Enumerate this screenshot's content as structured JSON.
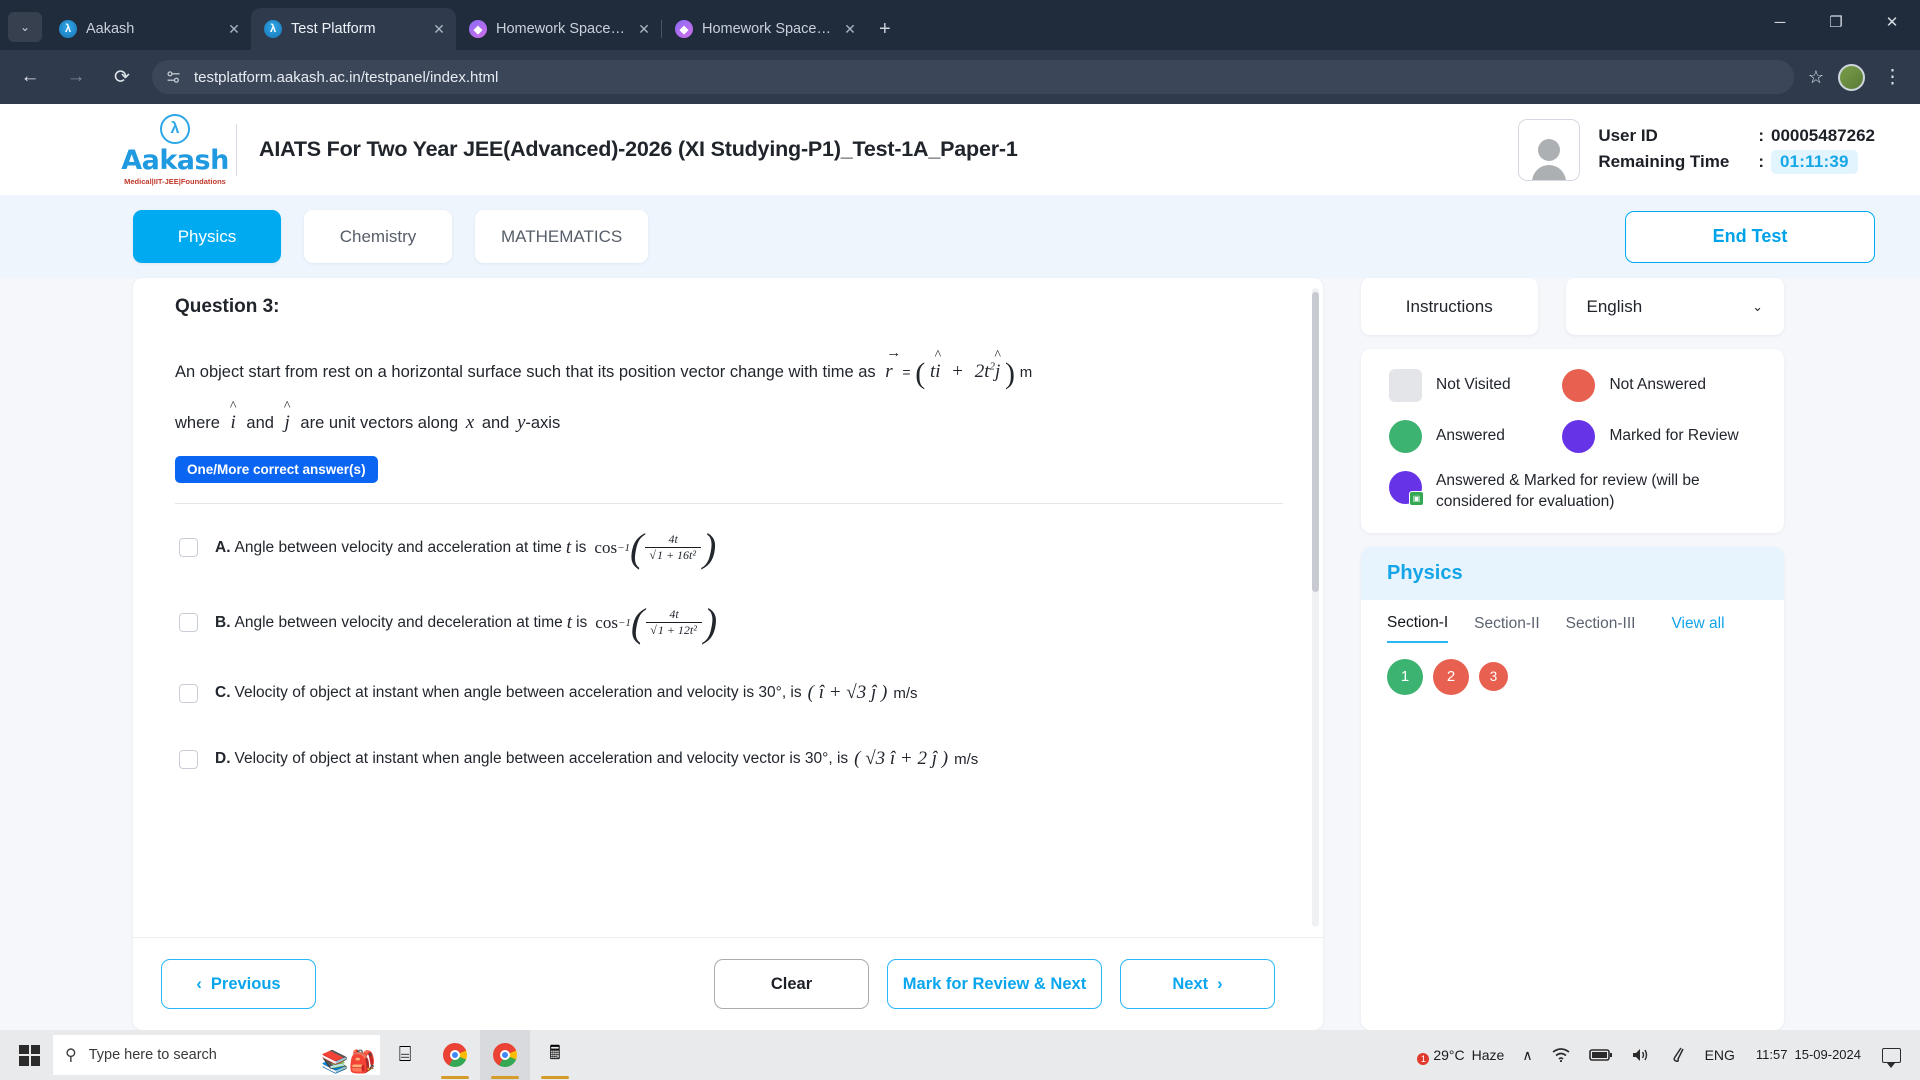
{
  "browser": {
    "tabs": [
      {
        "title": "Aakash",
        "favicon": "aakash-icon",
        "active": false,
        "close_label": "✕"
      },
      {
        "title": "Test Platform",
        "favicon": "aakash-icon",
        "active": true,
        "close_label": "✕"
      },
      {
        "title": "Homework Space - StudyX",
        "favicon": "studyx-icon",
        "active": false,
        "close_label": "✕"
      },
      {
        "title": "Homework Space - StudyX",
        "favicon": "studyx-icon",
        "active": false,
        "close_label": "✕"
      }
    ],
    "new_tab_label": "+",
    "tab_list_label": "⌄",
    "window_controls": {
      "minimize": "─",
      "maximize": "❐",
      "close": "✕"
    },
    "back_label": "←",
    "forward_label": "→",
    "reload_label": "⟳",
    "url": "testplatform.aakash.ac.in/testpanel/index.html",
    "bookmark_label": "☆",
    "menu_label": "⋮"
  },
  "header": {
    "logo_word": "Aakash",
    "logo_sub": "Medical|IIT-JEE|Foundations",
    "test_title": "AIATS For Two Year JEE(Advanced)-2026 (XI Studying-P1)_Test-1A_Paper-1",
    "user_id_label": "User ID",
    "user_id_sep": ":",
    "user_id_value": "00005487262",
    "remaining_label": "Remaining Time",
    "remaining_sep": ":",
    "remaining_value": "01:11:39"
  },
  "subjects": {
    "tabs": [
      {
        "label": "Physics",
        "active": true
      },
      {
        "label": "Chemistry",
        "active": false
      },
      {
        "label": "MATHEMATICS",
        "active": false
      }
    ],
    "end_test_label": "End Test"
  },
  "question": {
    "number_label": "Question 3:",
    "stem_part1": "An object start from rest on a horizontal surface such that its position vector change with time as",
    "stem_vec": "r",
    "stem_eq": "=",
    "stem_expr_open": "(",
    "stem_expr_t1": "t",
    "stem_expr_i": "i",
    "stem_expr_plus": "+",
    "stem_expr_2t": "2t",
    "stem_expr_sup": "2",
    "stem_expr_j": "j",
    "stem_expr_close": ")",
    "stem_unit": "m",
    "stem_part2_a": "where",
    "stem_part2_i": "i",
    "stem_part2_and": "and",
    "stem_part2_j": "j",
    "stem_part2_b": "are unit vectors along",
    "stem_part2_x": "x",
    "stem_part2_and2": "and",
    "stem_part2_y": "y",
    "stem_part2_axis": "-axis",
    "answer_type_badge": "One/More correct answer(s)",
    "options": [
      {
        "letter": "A.",
        "text": "Angle between velocity and acceleration at time",
        "var": "t",
        "is_word": "is",
        "fn": "cos",
        "fn_sup": "−1",
        "num": "4t",
        "den_root": "√",
        "den": "1 + 16t²",
        "tail": "",
        "checked": false
      },
      {
        "letter": "B.",
        "text": "Angle between velocity and deceleration at time",
        "var": "t",
        "is_word": "is",
        "fn": "cos",
        "fn_sup": "−1",
        "num": "4t",
        "den_root": "√",
        "den": "1 + 12t²",
        "tail": "",
        "checked": false
      },
      {
        "letter": "C.",
        "text": "Velocity of object at instant when angle between acceleration and velocity is 30°, is",
        "expr": "( î + √3 ĵ )",
        "tail": "m/s",
        "checked": false
      },
      {
        "letter": "D.",
        "text": "Velocity of object at instant when angle between acceleration and velocity vector is 30°, is",
        "expr": "( √3 î + 2 ĵ )",
        "tail": "m/s",
        "checked": false
      }
    ],
    "footer": {
      "previous_label": "Previous",
      "previous_icon": "‹",
      "clear_label": "Clear",
      "mark_label": "Mark for Review & Next",
      "next_label": "Next",
      "next_icon": "›"
    }
  },
  "right_panel": {
    "instructions_label": "Instructions",
    "language_value": "English",
    "language_chevron": "⌄",
    "legend": [
      {
        "name": "not-visited",
        "label": "Not Visited",
        "color": "#e3e5e8",
        "shape": "square"
      },
      {
        "name": "not-answered",
        "label": "Not Answered",
        "color": "#e8604f",
        "shape": "circle"
      },
      {
        "name": "answered",
        "label": "Answered",
        "color": "#3cb371",
        "shape": "circle"
      },
      {
        "name": "marked-for-review",
        "label": "Marked for Review",
        "color": "#6633e6",
        "shape": "circle"
      },
      {
        "name": "answered-and-marked",
        "label": "Answered & Marked for review (will be considered for evaluation)",
        "color": "#6633e6",
        "shape": "circle-badge"
      }
    ],
    "palette": {
      "subject_title": "Physics",
      "sections": [
        {
          "label": "Section-I",
          "active": true
        },
        {
          "label": "Section-II",
          "active": false
        },
        {
          "label": "Section-III",
          "active": false
        }
      ],
      "view_all_label": "View all",
      "questions": [
        {
          "num": "1",
          "state": "answered",
          "color": "#3cb371",
          "small": false
        },
        {
          "num": "2",
          "state": "not-answered",
          "color": "#e8604f",
          "small": false
        },
        {
          "num": "3",
          "state": "not-answered",
          "color": "#e8604f",
          "small": true
        }
      ]
    }
  },
  "taskbar": {
    "start_label": "start-button",
    "search_placeholder": "Type here to search",
    "search_icon": "⌕",
    "task_view_icon": "⌸",
    "apps": [
      {
        "name": "chrome-icon",
        "running": true,
        "active": false
      },
      {
        "name": "chrome-icon-2",
        "running": true,
        "active": true
      },
      {
        "name": "calculator-icon",
        "running": true,
        "active": false
      }
    ],
    "weather_temp": "29°C",
    "weather_desc": "Haze",
    "weather_badge": "1",
    "overflow_icon": "∧",
    "wifi_icon": "wifi",
    "battery_icon": "battery",
    "volume_icon": "⦿",
    "pen_icon": "pen",
    "language": "ENG",
    "time": "11:57",
    "date": "15-09-2024",
    "action_center": "notification-icon"
  }
}
